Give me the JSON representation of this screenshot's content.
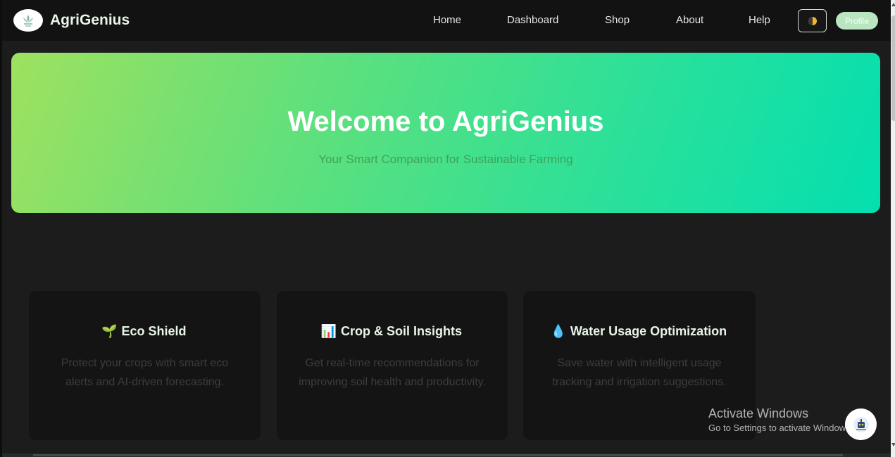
{
  "nav": {
    "brand": "AgriGenius",
    "links": [
      "Home",
      "Dashboard",
      "Shop",
      "About",
      "Help"
    ],
    "profile_label": "Profile",
    "theme_icon": "moon-half-icon"
  },
  "hero": {
    "title": "Welcome to AgriGenius",
    "subtitle": "Your Smart Companion for Sustainable Farming"
  },
  "cards": [
    {
      "icon": "🌱",
      "title": "Eco Shield",
      "description": "Protect your crops with smart eco alerts and AI-driven forecasting."
    },
    {
      "icon": "📊",
      "title": "Crop & Soil Insights",
      "description": "Get real-time recommendations for improving soil health and productivity."
    },
    {
      "icon": "💧",
      "title": "Water Usage Optimization",
      "description": "Save water with intelligent usage tracking and irrigation suggestions."
    }
  ],
  "watermark": {
    "title": "Activate Windows",
    "subtitle": "Go to Settings to activate Windows."
  },
  "colors": {
    "accent": "#5fe07c",
    "background": "#1c1c1c",
    "card": "#141414"
  }
}
